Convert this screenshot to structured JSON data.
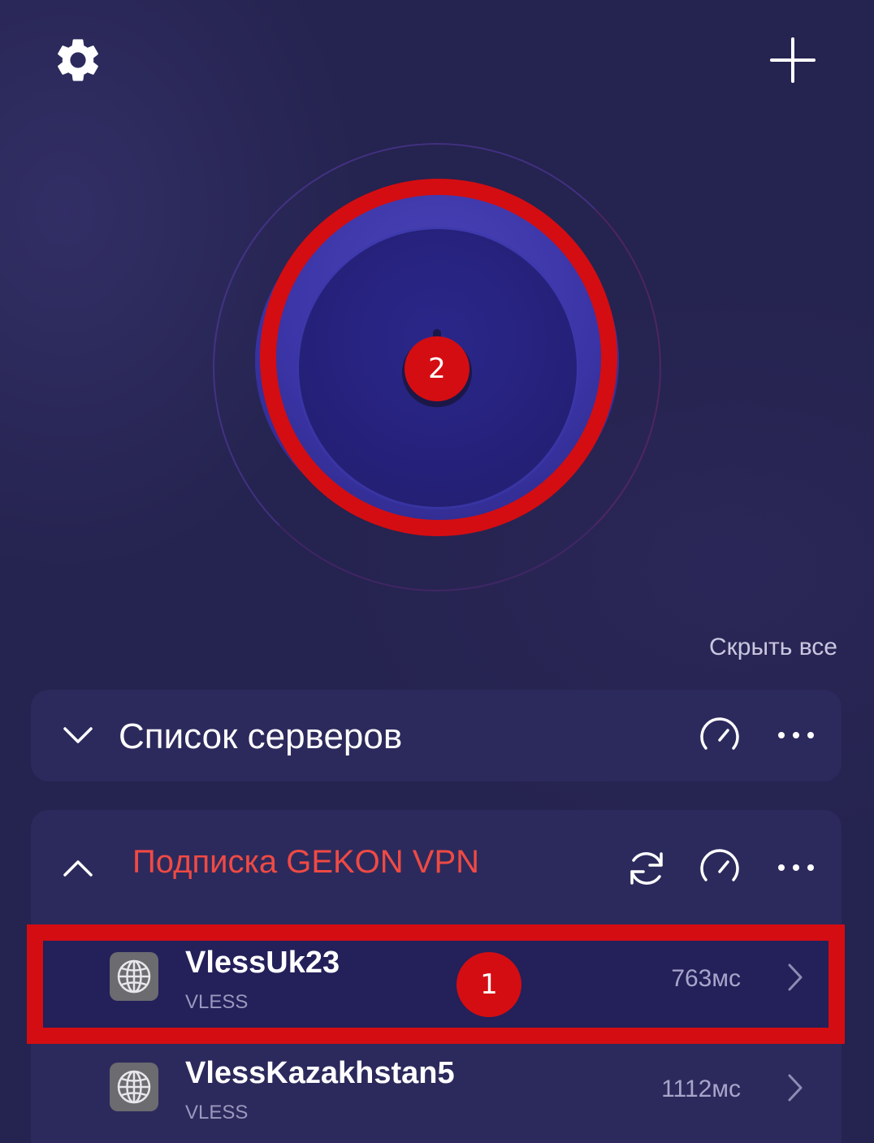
{
  "header": {
    "settings_icon": "gear-icon",
    "add_icon": "plus-icon"
  },
  "connect": {
    "icon": "power-icon",
    "badge": "2"
  },
  "hide_all_label": "Скрыть все",
  "server_list_group": {
    "title": "Список серверов",
    "expanded": false,
    "icons": [
      "chevron-down-icon",
      "speedometer-icon",
      "more-icon"
    ]
  },
  "subscription_group": {
    "title": "Подписка GEKON VPN",
    "expanded": true,
    "icons": [
      "chevron-up-icon",
      "refresh-icon",
      "speedometer-icon",
      "more-icon"
    ],
    "servers": [
      {
        "name": "VlessUk23",
        "protocol": "VLESS",
        "ping": "763мс",
        "badge": "1"
      },
      {
        "name": "VlessKazakhstan5",
        "protocol": "VLESS",
        "ping": "1112мс"
      }
    ]
  },
  "colors": {
    "background": "#25234f",
    "card": "#2c2a5c",
    "accent_red": "#d40d12",
    "subscription_title": "#ef4a44",
    "button": "#3a34a6"
  }
}
